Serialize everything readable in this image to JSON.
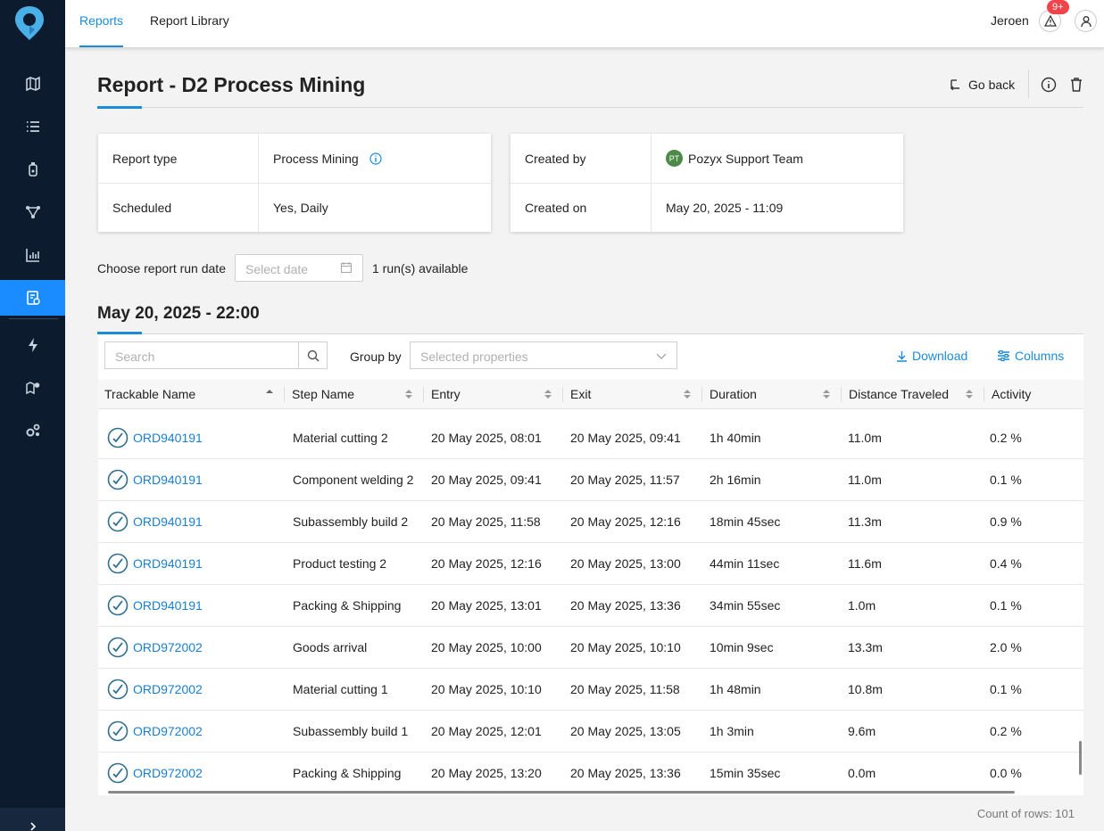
{
  "nav": {
    "tabs": [
      {
        "label": "Reports",
        "active": true
      },
      {
        "label": "Report Library",
        "active": false
      }
    ],
    "user_name": "Jeroen",
    "notification_badge": "9+",
    "sidebar_icons": [
      "map-icon",
      "list-icon",
      "tag-device-icon",
      "flow-icon",
      "analytics-icon",
      "report-icon",
      "lightning-icon",
      "map-settings-icon",
      "settings-icon"
    ],
    "active_sidebar": "report-icon"
  },
  "header": {
    "title": "Report - D2 Process Mining",
    "go_back_label": "Go back"
  },
  "info_card_left": {
    "rows": [
      {
        "label": "Report type",
        "value": "Process Mining"
      },
      {
        "label": "Scheduled",
        "value": "Yes, Daily"
      }
    ]
  },
  "info_card_right": {
    "rows": [
      {
        "label": "Created by",
        "value": "Pozyx Support Team",
        "avatar_initials": "PT"
      },
      {
        "label": "Created on",
        "value": "May 20, 2025 - 11:09"
      }
    ]
  },
  "run_selector": {
    "label": "Choose report run date",
    "placeholder": "Select date",
    "runs_text": "1 run(s) available"
  },
  "section": {
    "title": "May 20, 2025 - 22:00"
  },
  "toolbar": {
    "search_placeholder": "Search",
    "group_by_label": "Group by",
    "group_by_placeholder": "Selected properties",
    "download_label": "Download",
    "columns_label": "Columns"
  },
  "table": {
    "columns": [
      "Trackable Name",
      "Step Name",
      "Entry",
      "Exit",
      "Duration",
      "Distance Traveled",
      "Activity"
    ],
    "rows": [
      [
        "ORD940191",
        "Material cutting 2",
        "20 May 2025, 08:01",
        "20 May 2025, 09:41",
        "1h 40min",
        "11.0m",
        "0.2 %"
      ],
      [
        "ORD940191",
        "Component welding 2",
        "20 May 2025, 09:41",
        "20 May 2025, 11:57",
        "2h 16min",
        "11.0m",
        "0.1 %"
      ],
      [
        "ORD940191",
        "Subassembly build 2",
        "20 May 2025, 11:58",
        "20 May 2025, 12:16",
        "18min 45sec",
        "11.3m",
        "0.9 %"
      ],
      [
        "ORD940191",
        "Product testing 2",
        "20 May 2025, 12:16",
        "20 May 2025, 13:00",
        "44min 11sec",
        "11.6m",
        "0.4 %"
      ],
      [
        "ORD940191",
        "Packing & Shipping",
        "20 May 2025, 13:01",
        "20 May 2025, 13:36",
        "34min 55sec",
        "1.0m",
        "0.1 %"
      ],
      [
        "ORD972002",
        "Goods arrival",
        "20 May 2025, 10:00",
        "20 May 2025, 10:10",
        "10min 9sec",
        "13.3m",
        "2.0 %"
      ],
      [
        "ORD972002",
        "Material cutting 1",
        "20 May 2025, 10:10",
        "20 May 2025, 11:58",
        "1h 48min",
        "10.8m",
        "0.1 %"
      ],
      [
        "ORD972002",
        "Subassembly build 1",
        "20 May 2025, 12:01",
        "20 May 2025, 13:05",
        "1h 3min",
        "9.6m",
        "0.2 %"
      ],
      [
        "ORD972002",
        "Packing & Shipping",
        "20 May 2025, 13:20",
        "20 May 2025, 13:36",
        "15min 35sec",
        "0.0m",
        "0.0 %"
      ]
    ],
    "row_count_text": "Count of rows: 101"
  },
  "colors": {
    "accent": "#1a8cd8",
    "sidebar_bg": "#0d1b2e",
    "sidebar_active": "#1a8cff",
    "badge": "#f0434a"
  }
}
